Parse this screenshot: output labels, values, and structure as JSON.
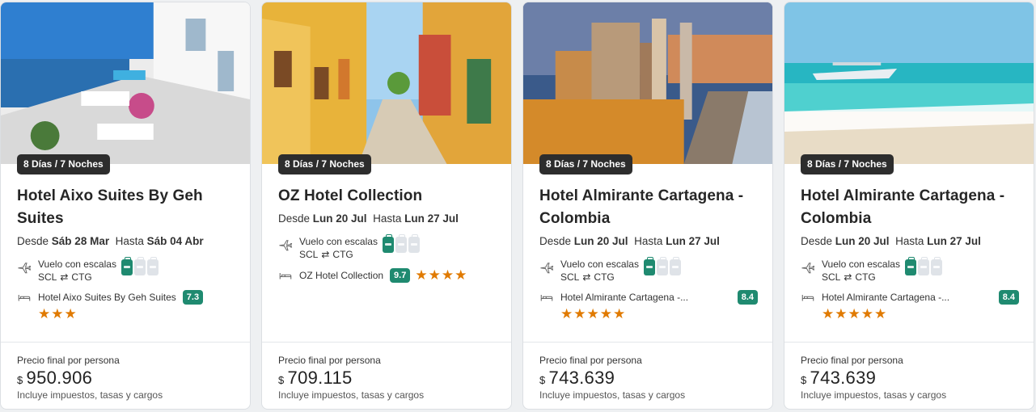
{
  "cards": [
    {
      "nights": "8 Días / 7 Noches",
      "title": "OZ Hotel Collection",
      "from_label": "Desde",
      "from_date": "Lun 20 Jul",
      "to_label": "Hasta",
      "to_date": "Lun 27 Jul",
      "flight_label": "Vuelo con escalas",
      "origin": "SCL",
      "destination": "CTG",
      "hotel": "OZ Hotel Collection",
      "score": "9.7",
      "stars": "★★★★",
      "price_label": "Precio final por persona",
      "currency": "$",
      "price": "709.115",
      "price_note": "Incluye impuestos, tasas y cargos"
    },
    {
      "nights": "8 Días / 7 Noches",
      "title": "Hotel Almirante Cartagena - Colombia",
      "from_label": "Desde",
      "from_date": "Lun 20 Jul",
      "to_label": "Hasta",
      "to_date": "Lun 27 Jul",
      "flight_label": "Vuelo con escalas",
      "origin": "SCL",
      "destination": "CTG",
      "hotel": "Hotel Almirante Cartagena -...",
      "score": "8.4",
      "stars": "★★★★★",
      "price_label": "Precio final por persona",
      "currency": "$",
      "price": "743.639",
      "price_note": "Incluye impuestos, tasas y cargos"
    },
    {
      "nights": "8 Días / 7 Noches",
      "title": "Hotel Almirante Cartagena - Colombia",
      "from_label": "Desde",
      "from_date": "Lun 20 Jul",
      "to_label": "Hasta",
      "to_date": "Lun 27 Jul",
      "flight_label": "Vuelo con escalas",
      "origin": "SCL",
      "destination": "CTG",
      "hotel": "Hotel Almirante Cartagena -...",
      "score": "8.4",
      "stars": "★★★★★",
      "price_label": "Precio final por persona",
      "currency": "$",
      "price": "743.639",
      "price_note": "Incluye impuestos, tasas y cargos"
    },
    {
      "nights": "8 Días / 7 Noches",
      "title": "Hotel Aixo Suites By Geh Suites",
      "from_label": "Desde",
      "from_date": "Sáb 28 Mar",
      "to_label": "Hasta",
      "to_date": "Sáb 04 Abr",
      "flight_label": "Vuelo con escalas",
      "origin": "SCL",
      "destination": "CTG",
      "hotel": "Hotel Aixo Suites By Geh Suites",
      "score": "7.3",
      "stars": "★★★",
      "price_label": "Precio final por persona",
      "currency": "$",
      "price": "950.906",
      "price_note": "Incluye impuestos, tasas y cargos"
    }
  ],
  "colors": {
    "score_bg": "#1f8a70",
    "stars": "#e07a00",
    "badge_bg": "#2d2d2d"
  },
  "icons": {
    "flight": "airplane-icon",
    "hotel": "bed-icon",
    "route": "round-trip-arrows-icon",
    "bags": "luggage-icon"
  }
}
